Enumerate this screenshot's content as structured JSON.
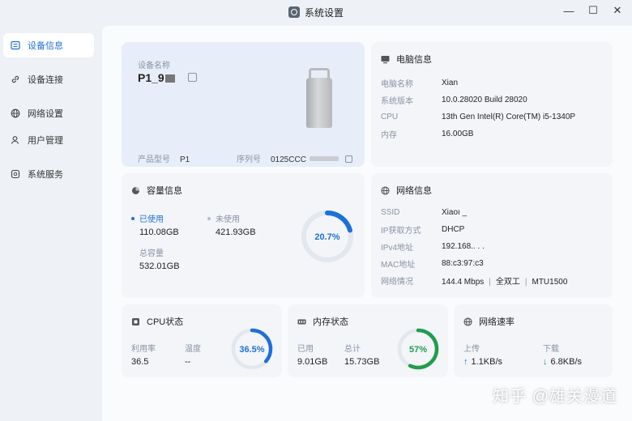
{
  "window": {
    "title": "系统设置",
    "minimize": "—",
    "maximize": "☐",
    "close": "✕"
  },
  "sidebar": {
    "items": [
      {
        "label": "设备信息",
        "icon": "device-list-icon",
        "active": true
      },
      {
        "label": "设备连接",
        "icon": "link-icon",
        "active": false
      },
      {
        "label": "网络设置",
        "icon": "globe-icon",
        "active": false
      },
      {
        "label": "用户管理",
        "icon": "user-icon",
        "active": false
      },
      {
        "label": "系统服务",
        "icon": "service-icon",
        "active": false
      }
    ]
  },
  "device": {
    "name_label": "设备名称",
    "name_value": "P1_9",
    "model_label": "产品型号",
    "model_value": "P1",
    "serial_label": "序列号",
    "serial_value": "0125CCC"
  },
  "pc": {
    "title": "电脑信息",
    "rows": [
      {
        "k": "电脑名称",
        "v": "Xian"
      },
      {
        "k": "系统版本",
        "v": "10.0.28020 Build 28020"
      },
      {
        "k": "CPU",
        "v": "13th Gen Intel(R) Core(TM) i5-1340P"
      },
      {
        "k": "内存",
        "v": "16.00GB"
      }
    ]
  },
  "capacity": {
    "title": "容量信息",
    "used_label": "已使用",
    "used_value": "110.08GB",
    "free_label": "未使用",
    "free_value": "421.93GB",
    "total_label": "总容量",
    "total_value": "532.01GB",
    "percent_text": "20.7%",
    "percent": 20.7,
    "color": "#1e6fd9"
  },
  "network": {
    "title": "网络信息",
    "rows": [
      {
        "k": "SSID",
        "v": "Xiaoı _"
      },
      {
        "k": "IP获取方式",
        "v": "DHCP"
      },
      {
        "k": "IPv4地址",
        "v": "192.168.. . ."
      },
      {
        "k": "MAC地址",
        "v": "88:c3:97:c3"
      }
    ],
    "status_label": "网络情况",
    "speed": "144.4 Mbps",
    "duplex": "全双工",
    "mtu": "MTU1500",
    "sep": "|"
  },
  "cpu": {
    "title": "CPU状态",
    "usage_label": "利用率",
    "usage_value": "36.5",
    "temp_label": "温度",
    "temp_value": "--",
    "percent_text": "36.5%",
    "percent": 36.5,
    "color": "#1e6fd9"
  },
  "memory": {
    "title": "内存状态",
    "used_label": "已用",
    "used_value": "9.01GB",
    "total_label": "总计",
    "total_value": "15.73GB",
    "percent_text": "57%",
    "percent": 57,
    "color": "#1f9e4a"
  },
  "speed": {
    "title": "网络速率",
    "up_label": "上传",
    "up_value": "1.1KB/s",
    "down_label": "下载",
    "down_value": "6.8KB/s"
  },
  "watermark": "知乎 @雄关漫道"
}
